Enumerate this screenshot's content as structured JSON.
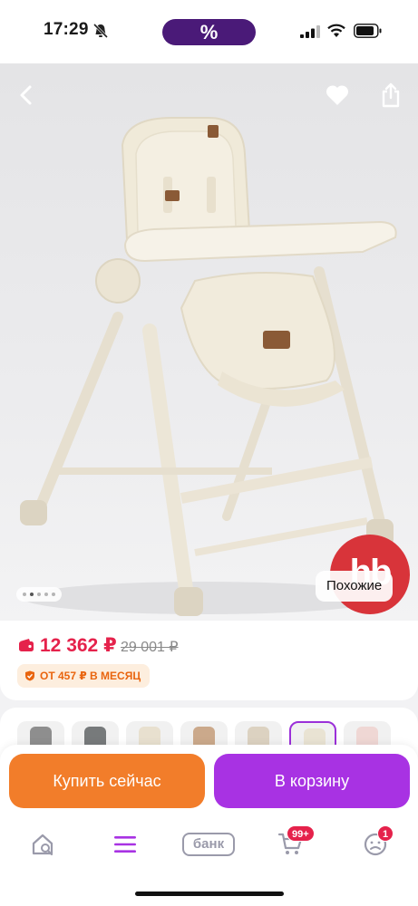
{
  "status_bar": {
    "time": "17:29",
    "promo_label": "%"
  },
  "product": {
    "similar_label": "Похожие",
    "brand_badge": "hb",
    "gallery_dots": 5,
    "gallery_active_index": 1
  },
  "price": {
    "current": "12 362 ₽",
    "old": "29 001 ₽",
    "installment": "ОТ 457 ₽ В МЕСЯЦ"
  },
  "variants": [
    {
      "color": "#8e8e8e"
    },
    {
      "color": "#777a7b"
    },
    {
      "color": "#e8e0cf"
    },
    {
      "color": "#cba98b"
    },
    {
      "color": "#dcd2c1"
    },
    {
      "color": "#e9e3d3",
      "selected": true
    },
    {
      "color": "#efd7d4"
    }
  ],
  "actions": {
    "buy_now": "Купить сейчас",
    "add_to_cart": "В корзину"
  },
  "tab_bar": {
    "bank_label": "банк",
    "cart_badge": "99+",
    "profile_badge": "1"
  },
  "colors": {
    "accent_purple": "#a832e3",
    "accent_orange": "#f27d2a",
    "price_red": "#e5224b"
  }
}
